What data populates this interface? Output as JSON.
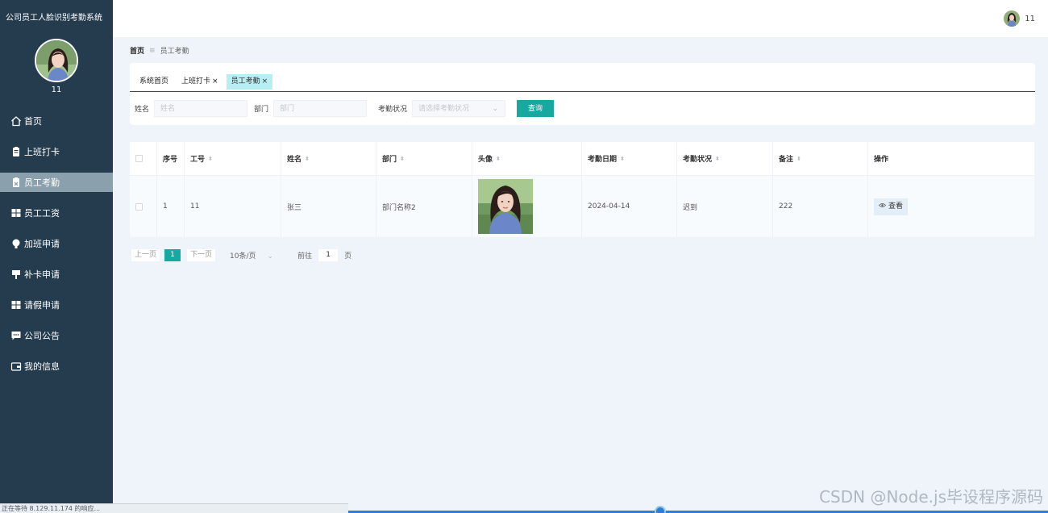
{
  "app": {
    "title": "公司员工人脸识别考勤系统",
    "username": "11"
  },
  "sidebar": {
    "items": [
      {
        "label": "首页",
        "icon": "home-icon"
      },
      {
        "label": "上班打卡",
        "icon": "clipboard-icon"
      },
      {
        "label": "员工考勤",
        "icon": "clipboard-check-icon",
        "active": true
      },
      {
        "label": "员工工资",
        "icon": "grid-icon"
      },
      {
        "label": "加班申请",
        "icon": "bulb-icon"
      },
      {
        "label": "补卡申请",
        "icon": "brush-icon"
      },
      {
        "label": "请假申请",
        "icon": "grid-icon"
      },
      {
        "label": "公司公告",
        "icon": "chat-icon"
      },
      {
        "label": "我的信息",
        "icon": "wallet-icon"
      }
    ]
  },
  "header": {
    "username": "11"
  },
  "breadcrumb": {
    "home": "首页",
    "separator": "≡",
    "current": "员工考勤"
  },
  "tabs": [
    {
      "label": "系统首页",
      "closable": false
    },
    {
      "label": "上班打卡",
      "closable": true
    },
    {
      "label": "员工考勤",
      "closable": true,
      "active": true
    }
  ],
  "filters": {
    "name_label": "姓名",
    "name_placeholder": "姓名",
    "dept_label": "部门",
    "dept_placeholder": "部门",
    "status_label": "考勤状况",
    "status_placeholder": "请选择考勤状况",
    "query_button": "查询"
  },
  "table": {
    "columns": [
      "序号",
      "工号",
      "姓名",
      "部门",
      "头像",
      "考勤日期",
      "考勤状况",
      "备注",
      "操作"
    ],
    "rows": [
      {
        "index": "1",
        "emp_no": "11",
        "name": "张三",
        "dept": "部门名称2",
        "date": "2024-04-14",
        "status": "迟到",
        "remark": "222",
        "action": "查看"
      }
    ]
  },
  "pagination": {
    "prev": "上一页",
    "current": "1",
    "next": "下一页",
    "page_size": "10条/页",
    "goto": "前往",
    "goto_value": "1",
    "page_unit": "页"
  },
  "status_bar": "正在等待 8.129.11.174 的响应...",
  "watermark": "CSDN @Node.js毕设程序源码",
  "colors": {
    "sidebar": "#253c4f",
    "accent": "#17a8a0",
    "active_menu": "#8aa0ad",
    "tab_active": "#b7eef3"
  }
}
